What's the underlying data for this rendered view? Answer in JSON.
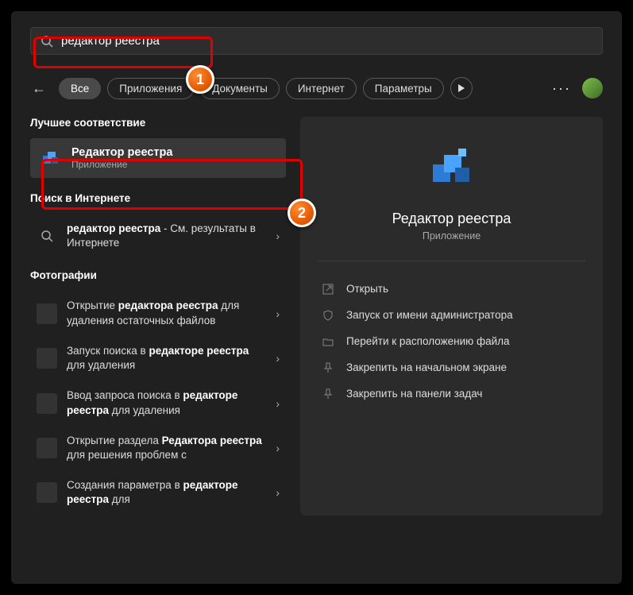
{
  "search": {
    "value": "редактор реестра"
  },
  "tabs": {
    "all": "Все",
    "apps": "Приложения",
    "docs": "Документы",
    "web": "Интернет",
    "settings": "Параметры"
  },
  "sections": {
    "best_match": "Лучшее соответствие",
    "web_search": "Поиск в Интернете",
    "photos": "Фотографии"
  },
  "best": {
    "title": "Редактор реестра",
    "subtitle": "Приложение"
  },
  "web_item": {
    "prefix": "редактор реестра",
    "suffix": " - См. результаты в Интернете"
  },
  "photos": [
    {
      "p1": "Открытие ",
      "b1": "редактора реестра",
      "p2": " для удаления остаточных файлов"
    },
    {
      "p1": "Запуск поиска в ",
      "b1": "редакторе реестра",
      "p2": " для удаления"
    },
    {
      "p1": "Ввод запроса поиска в ",
      "b1": "редакторе реестра",
      "p2": " для удаления"
    },
    {
      "p1": "Открытие раздела ",
      "b1": "Редактора реестра",
      "p2": " для решения проблем с"
    },
    {
      "p1": "Создания параметра в ",
      "b1": "редакторе реестра",
      "p2": " для"
    }
  ],
  "preview": {
    "title": "Редактор реестра",
    "subtitle": "Приложение",
    "actions": {
      "open": "Открыть",
      "admin": "Запуск от имени администратора",
      "location": "Перейти к расположению файла",
      "pin_start": "Закрепить на начальном экране",
      "pin_task": "Закрепить на панели задач"
    }
  },
  "markers": {
    "one": "1",
    "two": "2"
  }
}
